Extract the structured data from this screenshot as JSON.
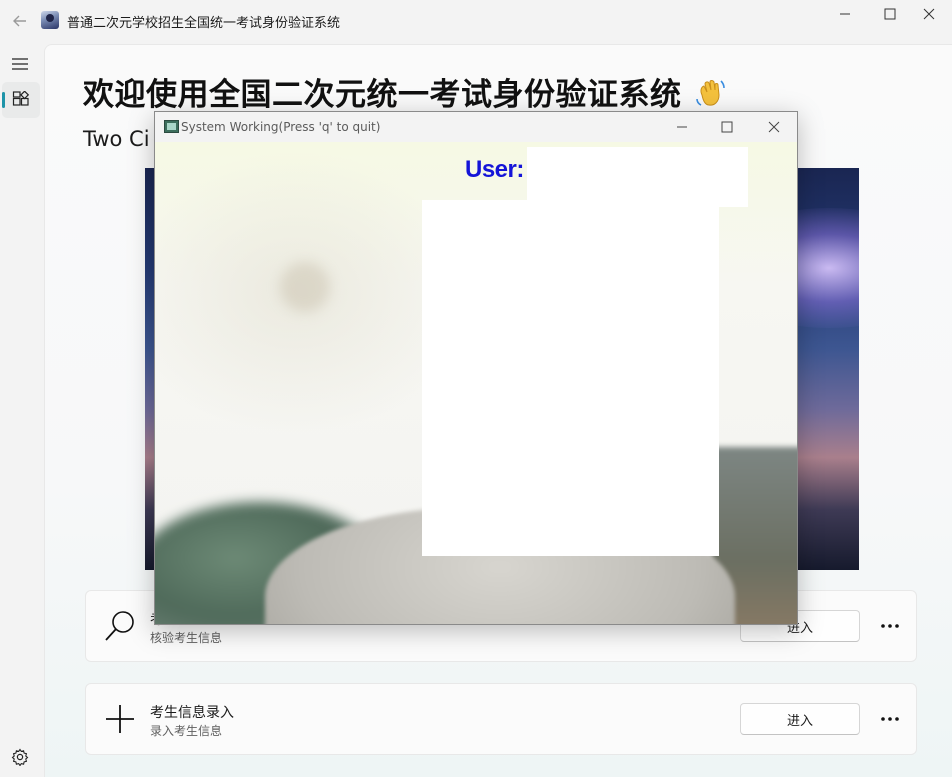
{
  "window": {
    "title": "普通二次元学校招生全国统一考试身份验证系统"
  },
  "page": {
    "title": "欢迎使用全国二次元统一考试身份验证系统",
    "subtitle": "Two Ci"
  },
  "cards": [
    {
      "title": "考",
      "description": "核验考生信息",
      "button_label": "进入",
      "icon": "search-icon"
    },
    {
      "title": "考生信息录入",
      "description": "录入考生信息",
      "button_label": "进入",
      "icon": "add-icon"
    }
  ],
  "camera_window": {
    "title": "System Working(Press 'q' to quit)",
    "user_label": "User:"
  },
  "colors": {
    "nav_indicator": "#1d93a8",
    "user_label": "#1414d8"
  }
}
